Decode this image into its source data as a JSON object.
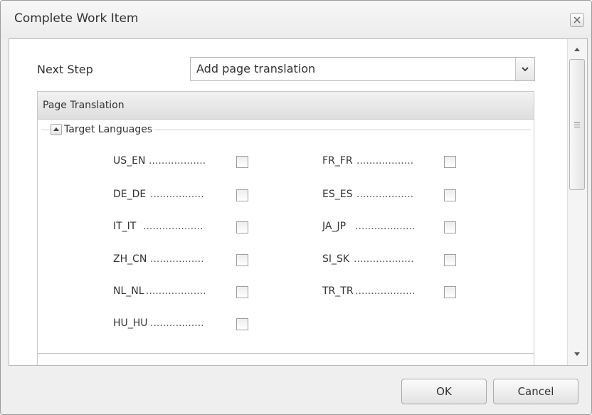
{
  "dialog": {
    "title": "Complete Work Item"
  },
  "form": {
    "next_step_label": "Next Step",
    "next_step_value": "Add page translation"
  },
  "panel": {
    "title": "Page Translation",
    "fieldset_title": "Target Languages",
    "languages_left": [
      {
        "code": "US_EN",
        "checked": false
      },
      {
        "code": "DE_DE",
        "checked": false
      },
      {
        "code": "IT_IT",
        "checked": false
      },
      {
        "code": "ZH_CN",
        "checked": false
      },
      {
        "code": "NL_NL",
        "checked": false
      },
      {
        "code": "HU_HU",
        "checked": false
      }
    ],
    "languages_right": [
      {
        "code": "FR_FR",
        "checked": false
      },
      {
        "code": "ES_ES",
        "checked": false
      },
      {
        "code": "JA_JP",
        "checked": false
      },
      {
        "code": "SI_SK",
        "checked": false
      },
      {
        "code": "TR_TR",
        "checked": false
      }
    ]
  },
  "buttons": {
    "ok_label": "OK",
    "cancel_label": "Cancel"
  },
  "icons": {
    "close": "close-icon",
    "dropdown": "chevron-down-icon",
    "collapse": "collapse-up-icon",
    "scroll_up": "arrow-up-icon",
    "scroll_down": "arrow-down-icon"
  }
}
